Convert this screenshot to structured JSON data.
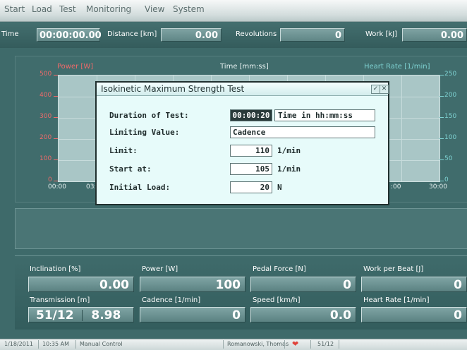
{
  "menu": [
    "Start",
    "Load",
    "Test",
    "Monitoring",
    "View",
    "System"
  ],
  "top": {
    "time_label": "Time",
    "time_value": "00:00:00.00",
    "distance_label": "Distance [km]",
    "distance_value": "0.00",
    "revolutions_label": "Revolutions",
    "revolutions_value": "0",
    "work_label": "Work [kJ]",
    "work_value": "0.00"
  },
  "chart": {
    "left_axis_label": "Power [W]",
    "center_label": "Time [mm:ss]",
    "right_axis_label": "Heart Rate [1/min]",
    "y_left_ticks": [
      "500",
      "400",
      "300",
      "200",
      "100",
      "0"
    ],
    "y_right_ticks": [
      "250",
      "200",
      "150",
      "100",
      "50",
      "0"
    ],
    "x_ticks": [
      "00:00",
      "03:",
      "",
      "",
      ":00",
      "30:00"
    ],
    "colors": {
      "power": "#ef6a6a",
      "heart_rate": "#7ed2d2"
    }
  },
  "chart_data": {
    "type": "line",
    "xlabel": "Time [mm:ss]",
    "ylabel": "Power [W]",
    "y2label": "Heart Rate [1/min]",
    "ylim": [
      0,
      500
    ],
    "y2lim": [
      0,
      250
    ],
    "x_range": [
      "00:00",
      "30:00"
    ],
    "series": [],
    "grid": true
  },
  "dialog": {
    "title": "Isokinetic Maximum Strength Test",
    "duration_label": "Duration of Test:",
    "duration_value": "00:00:20",
    "duration_hint": "Time in hh:mm:ss",
    "limiting_label": "Limiting Value:",
    "limiting_value": "Cadence",
    "limit_label": "Limit:",
    "limit_value": "110",
    "limit_unit": "1/min",
    "start_label": "Start at:",
    "start_value": "105",
    "start_unit": "1/min",
    "initial_label": "Initial Load:",
    "initial_value": "20",
    "initial_unit": "N"
  },
  "metrics": {
    "inclination_label": "Inclination [%]",
    "inclination_value": "0.00",
    "power_label": "Power [W]",
    "power_value": "100",
    "pedal_label": "Pedal Force [N]",
    "pedal_value": "0",
    "workbeat_label": "Work per Beat [J]",
    "workbeat_value": "0",
    "transmission_label": "Transmission [m]",
    "transmission_gear": "51/12",
    "transmission_value": "8.98",
    "cadence_label": "Cadence [1/min]",
    "cadence_value": "0",
    "speed_label": "Speed [km/h]",
    "speed_value": "0.0",
    "hr_label": "Heart Rate [1/min]",
    "hr_value": "0"
  },
  "status": {
    "date": "1/18/2011",
    "time": "10:35 AM",
    "mode": "Manual Control",
    "user": "Romanowski, Thomas",
    "gear": "51/12"
  }
}
